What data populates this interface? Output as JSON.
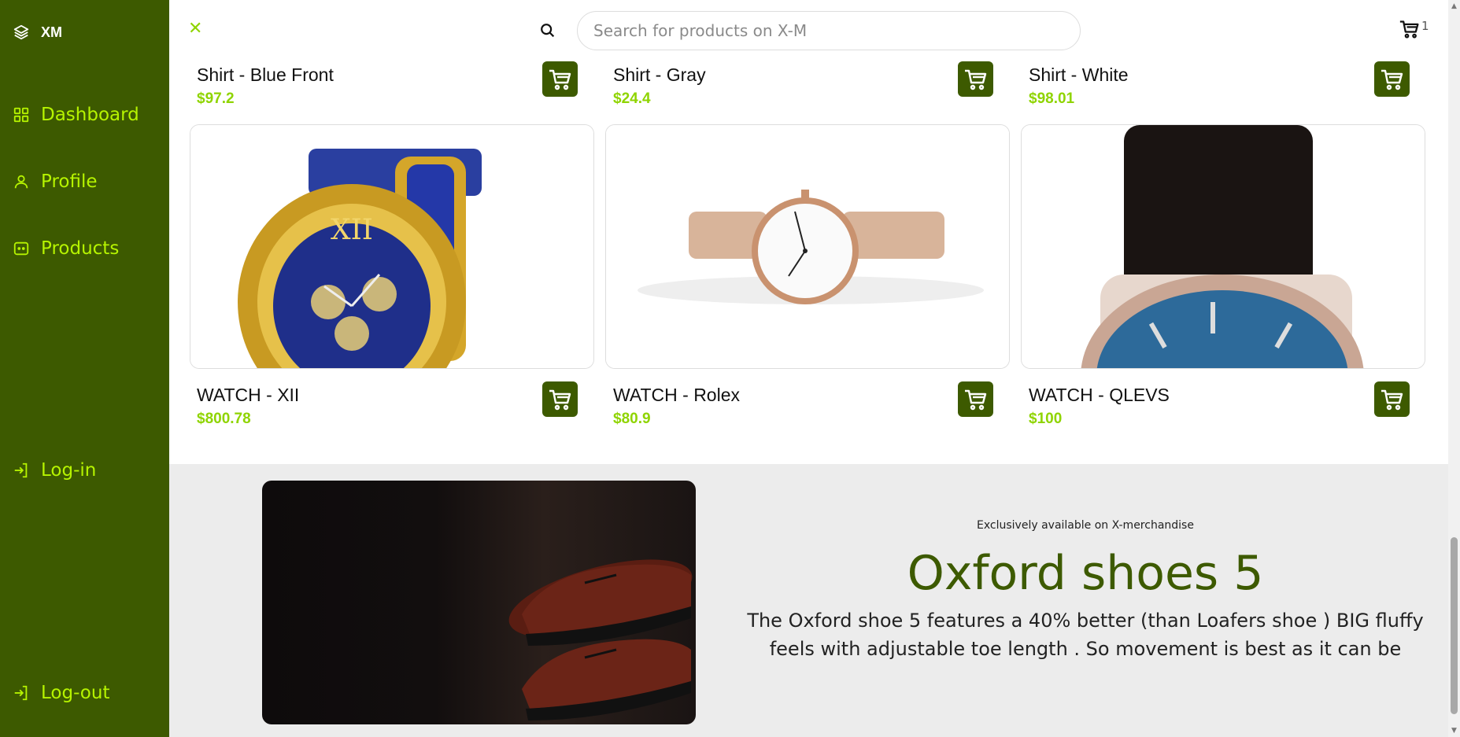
{
  "brand": {
    "name": "XM"
  },
  "sidebar": {
    "items": [
      {
        "label": "Dashboard",
        "icon": "grid-icon"
      },
      {
        "label": "Profile",
        "icon": "user-icon"
      },
      {
        "label": "Products",
        "icon": "products-icon"
      },
      {
        "label": "Log-in",
        "icon": "login-icon"
      },
      {
        "label": "Log-out",
        "icon": "logout-icon"
      }
    ]
  },
  "topbar": {
    "close_label": "✕",
    "search_placeholder": "Search for products on X-M",
    "cart_count": "1"
  },
  "products": [
    {
      "name": "Shirt - Blue Front",
      "price": "$97.2"
    },
    {
      "name": "Shirt - Gray",
      "price": "$24.4"
    },
    {
      "name": "Shirt - White",
      "price": "$98.01"
    },
    {
      "name": "WATCH - XII",
      "price": "$800.78"
    },
    {
      "name": "WATCH - Rolex",
      "price": "$80.9"
    },
    {
      "name": "WATCH - QLEVS",
      "price": "$100"
    }
  ],
  "promo": {
    "kicker": "Exclusively available on X-merchandise",
    "title": "Oxford shoes 5",
    "description": "The Oxford shoe 5 features a 40% better (than Loafers shoe ) BIG fluffy feels with adjustable toe length . So movement is best as it can be"
  },
  "colors": {
    "sidebar_bg": "#3d5a00",
    "accent": "#b6f400",
    "price": "#8fd400",
    "promo_bg": "#ececec"
  }
}
